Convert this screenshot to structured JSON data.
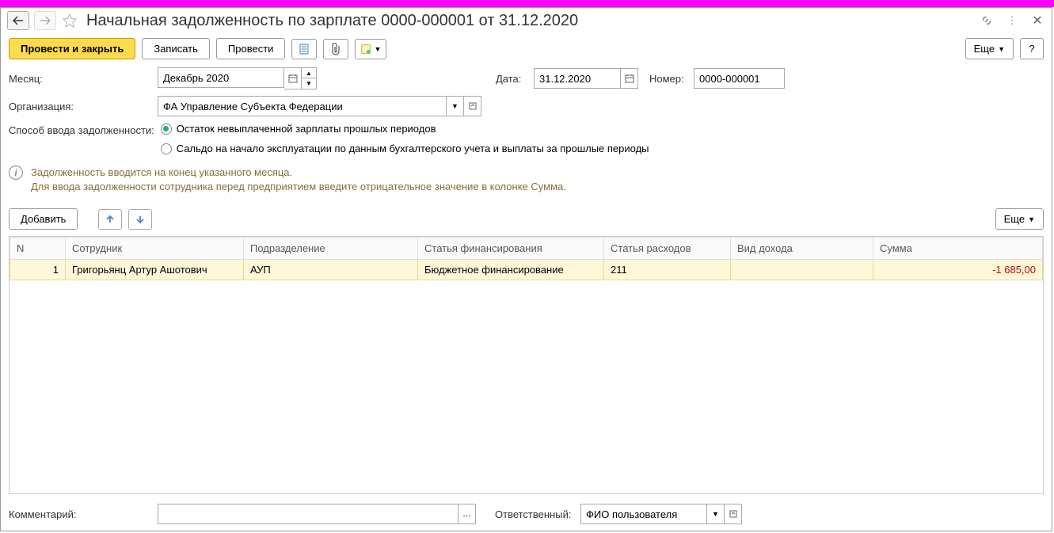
{
  "header": {
    "title": "Начальная задолженность по зарплате 0000-000001 от 31.12.2020"
  },
  "toolbar": {
    "post_close": "Провести и закрыть",
    "save": "Записать",
    "post": "Провести",
    "more": "Еще",
    "help": "?"
  },
  "form": {
    "month_label": "Месяц:",
    "month_value": "Декабрь 2020",
    "date_label": "Дата:",
    "date_value": "31.12.2020",
    "number_label": "Номер:",
    "number_value": "0000-000001",
    "org_label": "Организация:",
    "org_value": "ФА Управление Субъекта Федерации",
    "method_label": "Способ ввода задолженности:",
    "method_option1": "Остаток невыплаченной зарплаты прошлых периодов",
    "method_option2": "Сальдо на начало эксплуатации по данным бухгалтерского учета и выплаты за прошлые периоды"
  },
  "info": {
    "line1": "Задолженность вводится на конец указанного месяца.",
    "line2": "Для ввода задолженности сотрудника перед предприятием введите отрицательное значение в колонке Сумма."
  },
  "table_toolbar": {
    "add": "Добавить",
    "more": "Еще"
  },
  "table": {
    "headers": {
      "n": "N",
      "employee": "Сотрудник",
      "department": "Подразделение",
      "fin_article": "Статья финансирования",
      "exp_article": "Статья расходов",
      "income_type": "Вид дохода",
      "sum": "Сумма"
    },
    "rows": [
      {
        "n": "1",
        "employee": "Григорьянц Артур Ашотович",
        "department": "АУП",
        "fin_article": "Бюджетное финансирование",
        "exp_article": "211",
        "income_type": "",
        "sum": "-1 685,00"
      }
    ]
  },
  "footer": {
    "comment_label": "Комментарий:",
    "comment_value": "",
    "responsible_label": "Ответственный:",
    "responsible_value": "ФИО пользователя"
  }
}
